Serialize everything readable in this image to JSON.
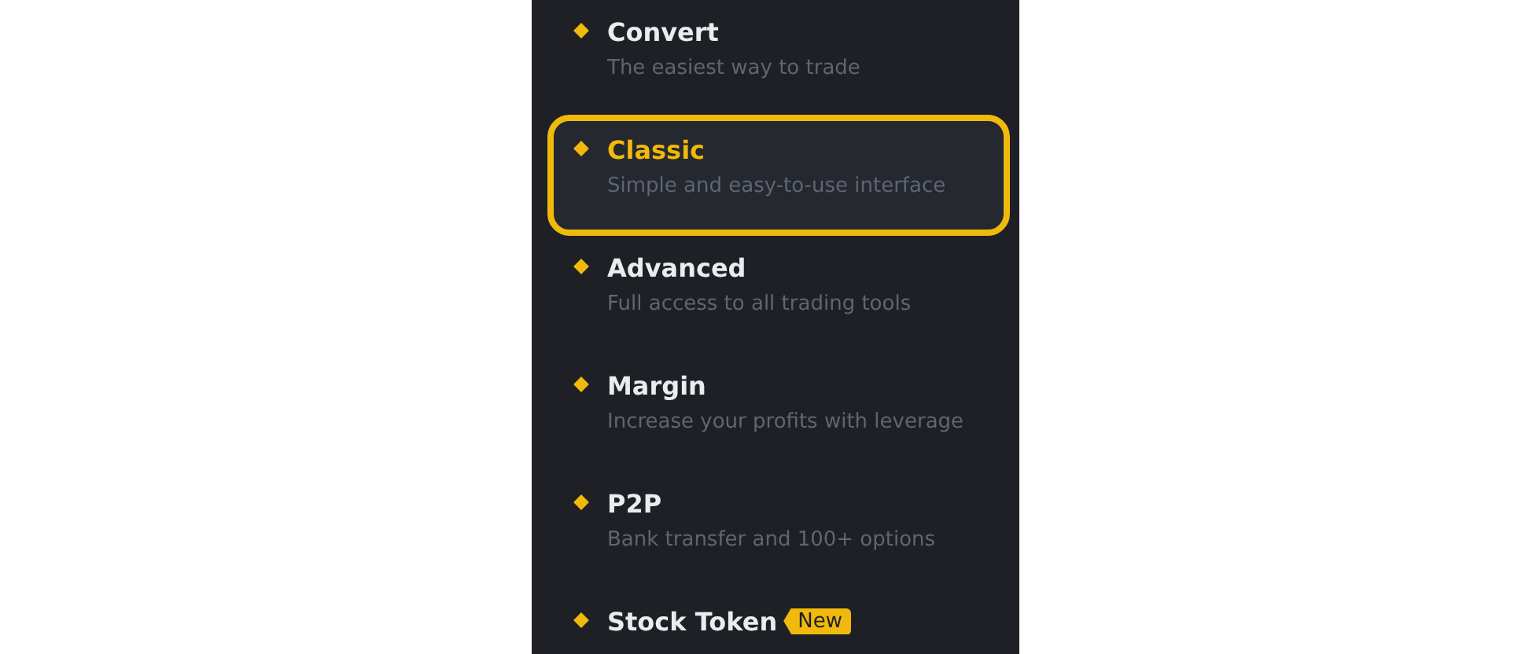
{
  "menu": {
    "items": [
      {
        "title": "Convert",
        "subtitle": "The easiest way to trade",
        "selected": false
      },
      {
        "title": "Classic",
        "subtitle": "Simple and easy-to-use interface",
        "selected": true
      },
      {
        "title": "Advanced",
        "subtitle": "Full access to all trading tools",
        "selected": false
      },
      {
        "title": "Margin",
        "subtitle": "Increase your profits with leverage",
        "selected": false
      },
      {
        "title": "P2P",
        "subtitle": "Bank transfer and 100+ options",
        "selected": false
      },
      {
        "title": "Stock Token",
        "badge": "New",
        "selected": false
      }
    ]
  }
}
